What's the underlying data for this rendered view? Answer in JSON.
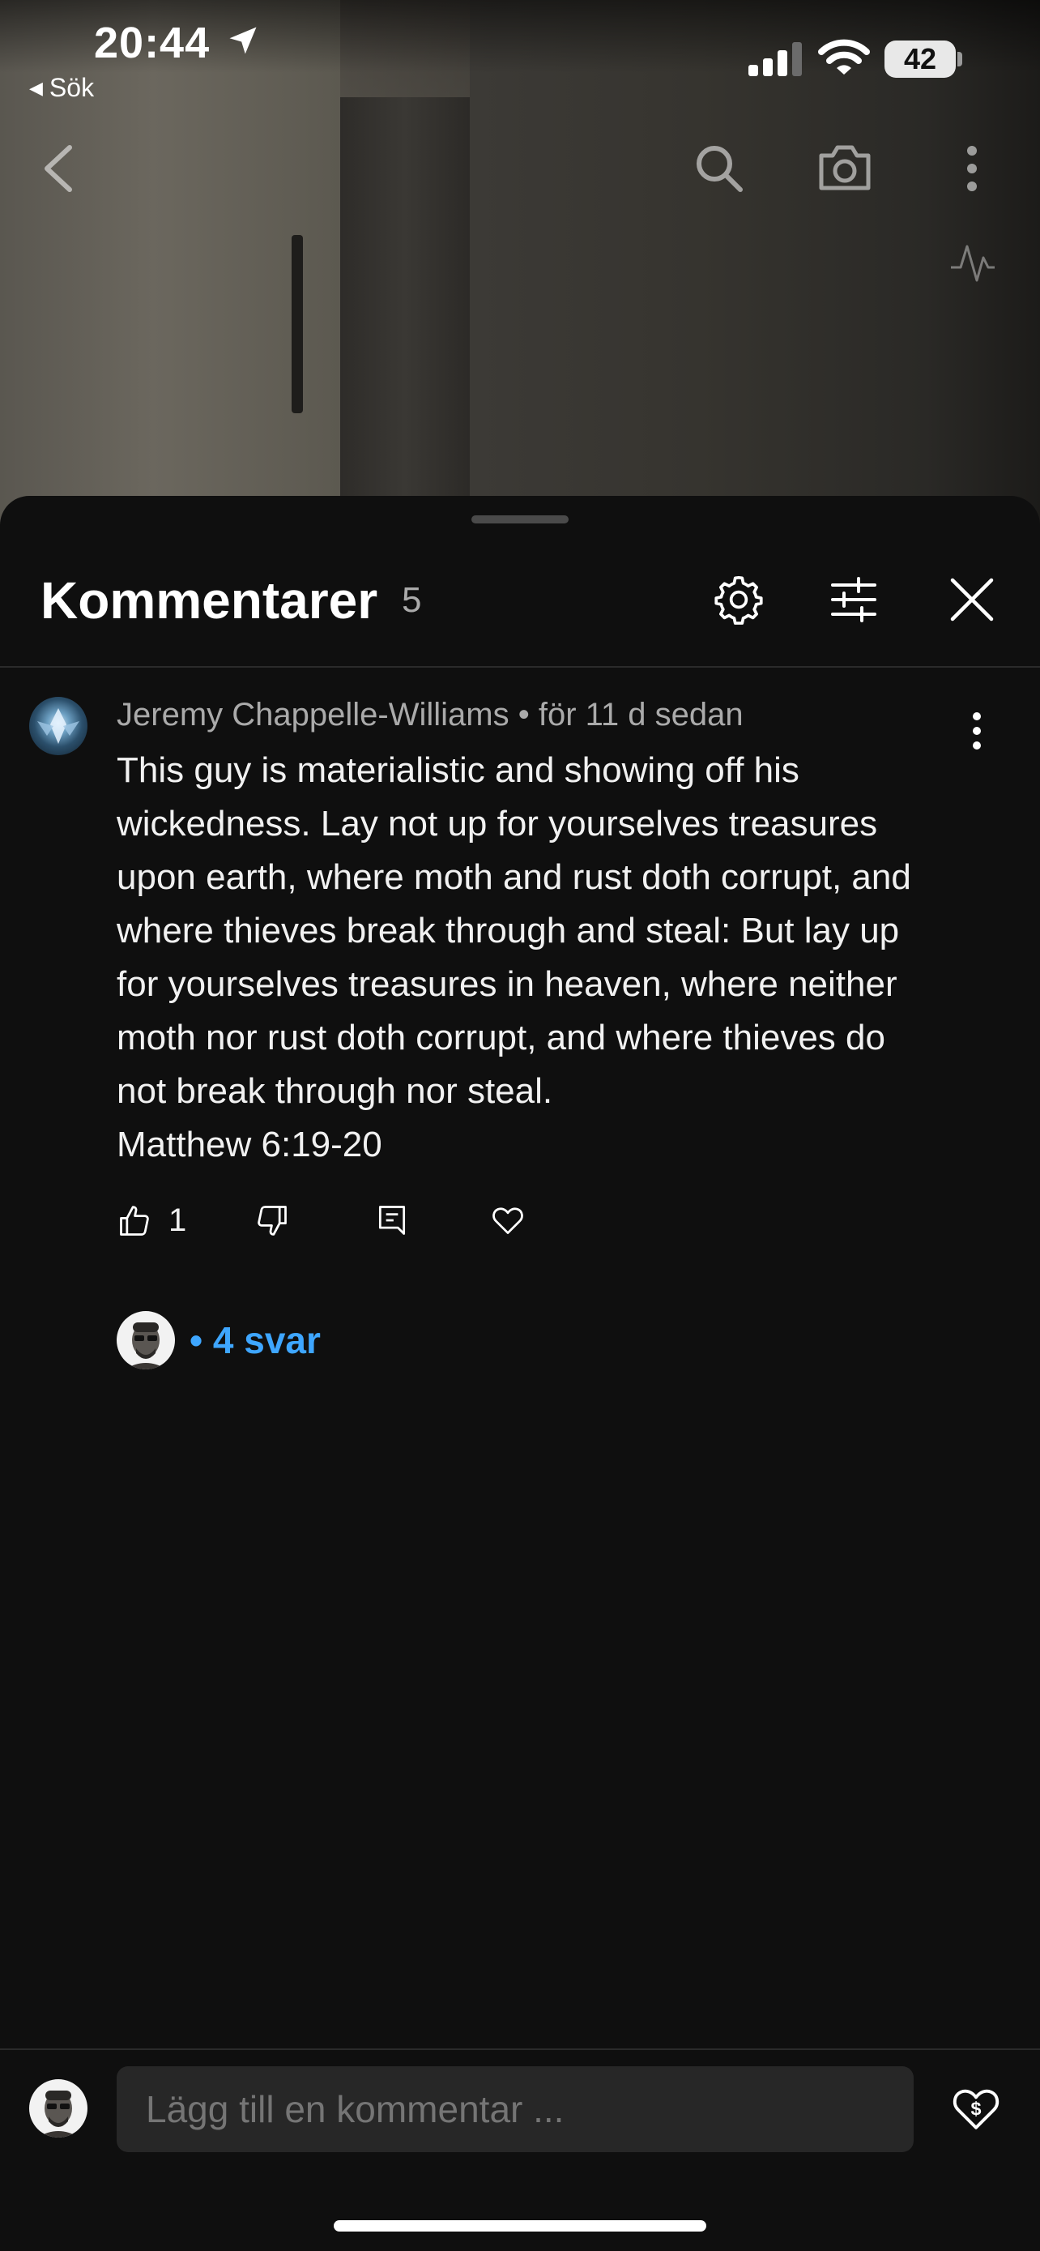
{
  "status_bar": {
    "time": "20:44",
    "back_app": "Sök",
    "battery": "42"
  },
  "video_overlay": {
    "icons": [
      "back-icon",
      "search-icon",
      "camera-icon",
      "more-vert-icon",
      "activity-icon"
    ]
  },
  "comments_sheet": {
    "title": "Kommentarer",
    "count": "5",
    "header_icons": [
      "settings-icon",
      "filter-icon",
      "close-icon"
    ]
  },
  "comment": {
    "author": "Jeremy Chappelle-Williams",
    "time": "för 11 d sedan",
    "body": "This guy is materialistic and showing off his\nwickedness. Lay not up for yourselves treasures\nupon earth, where moth and rust doth corrupt, and\nwhere thieves break through and steal: But lay up\nfor yourselves treasures in heaven, where neither\nmoth nor rust doth corrupt, and where thieves do\nnot break through nor steal.\nMatthew 6:19-20",
    "likes": "1",
    "replies": "• 4 svar"
  },
  "composer": {
    "placeholder": "Lägg till en kommentar ..."
  },
  "colors": {
    "background": "#0f0f0f",
    "accent_link": "#3ea6ff",
    "input_bg": "#272727",
    "meta_text": "#aaaaaa"
  }
}
